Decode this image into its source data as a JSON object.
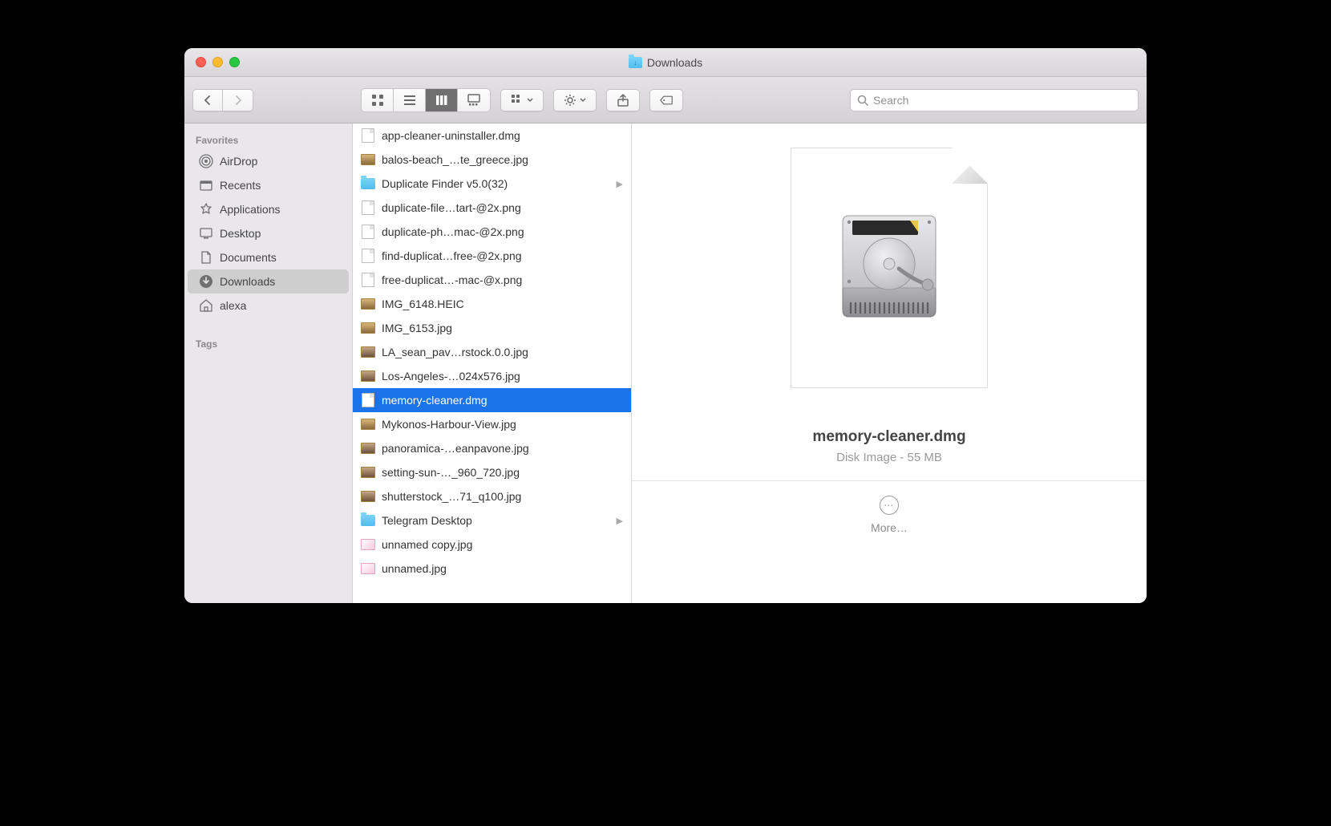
{
  "window": {
    "title": "Downloads"
  },
  "toolbar": {
    "search_placeholder": "Search"
  },
  "sidebar": {
    "section_favorites": "Favorites",
    "section_tags": "Tags",
    "items": [
      {
        "label": "AirDrop",
        "icon": "airdrop"
      },
      {
        "label": "Recents",
        "icon": "recents"
      },
      {
        "label": "Applications",
        "icon": "apps"
      },
      {
        "label": "Desktop",
        "icon": "desktop"
      },
      {
        "label": "Documents",
        "icon": "documents"
      },
      {
        "label": "Downloads",
        "icon": "downloads",
        "selected": true
      },
      {
        "label": "alexa",
        "icon": "home"
      }
    ]
  },
  "column": {
    "rows": [
      {
        "label": "app-cleaner-uninstaller.dmg",
        "type": "doc"
      },
      {
        "label": "balos-beach_…te_greece.jpg",
        "type": "img"
      },
      {
        "label": "Duplicate Finder v5.0(32)",
        "type": "folder",
        "arrow": true
      },
      {
        "label": "duplicate-file…tart-@2x.png",
        "type": "doc"
      },
      {
        "label": "duplicate-ph…mac-@2x.png",
        "type": "doc"
      },
      {
        "label": "find-duplicat…free-@2x.png",
        "type": "doc"
      },
      {
        "label": "free-duplicat…-mac-@x.png",
        "type": "doc"
      },
      {
        "label": "IMG_6148.HEIC",
        "type": "img"
      },
      {
        "label": "IMG_6153.jpg",
        "type": "img"
      },
      {
        "label": "LA_sean_pav…rstock.0.0.jpg",
        "type": "imgalt"
      },
      {
        "label": "Los-Angeles-…024x576.jpg",
        "type": "imgalt"
      },
      {
        "label": "memory-cleaner.dmg",
        "type": "doc",
        "selected": true
      },
      {
        "label": "Mykonos-Harbour-View.jpg",
        "type": "img"
      },
      {
        "label": "panoramica-…eanpavone.jpg",
        "type": "imgalt"
      },
      {
        "label": "setting-sun-…_960_720.jpg",
        "type": "imgalt"
      },
      {
        "label": "shutterstock_…71_q100.jpg",
        "type": "imgalt"
      },
      {
        "label": "Telegram Desktop",
        "type": "folder",
        "arrow": true
      },
      {
        "label": "unnamed copy.jpg",
        "type": "pink"
      },
      {
        "label": "unnamed.jpg",
        "type": "pink"
      }
    ]
  },
  "preview": {
    "filename": "memory-cleaner.dmg",
    "subtitle": "Disk Image - 55 MB",
    "more_label": "More…"
  }
}
